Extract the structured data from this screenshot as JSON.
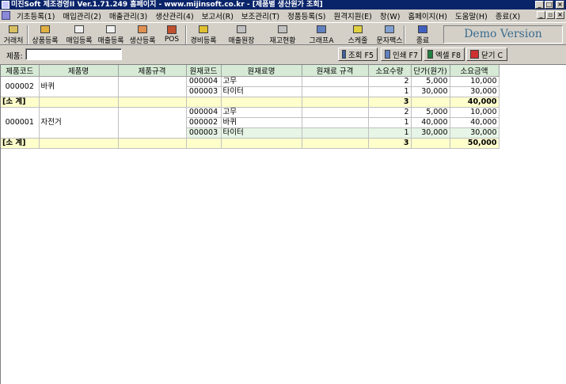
{
  "window": {
    "title": "미진Soft 제조경영II Ver.1.71.249        홈페이지 - www.mijinsoft.co.kr - [제품별 생산원가 조회]",
    "min": "_",
    "max": "□",
    "close": "×",
    "child_min": "_",
    "child_restore": "▫",
    "child_close": "×"
  },
  "menu": [
    "기초등록(1)",
    "매입관리(2)",
    "매출관리(3)",
    "생산관리(4)",
    "보고서(R)",
    "보조관리(T)",
    "정품등록(S)",
    "원격지원(E)",
    "창(W)",
    "홈페이지(H)",
    "도움말(H)",
    "종료(X)"
  ],
  "toolbar": [
    {
      "label": "거래처",
      "icon": "client-book-icon",
      "color": "#d8c060"
    },
    {
      "label": "상품등록",
      "icon": "product-box-icon",
      "color": "#e0b040"
    },
    {
      "label": "매입등록",
      "icon": "purchase-doc-icon",
      "color": "#f0f0f0"
    },
    {
      "label": "매출등록",
      "icon": "sales-doc-icon",
      "color": "#f0f0f0"
    },
    {
      "label": "생산등록",
      "icon": "production-icon",
      "color": "#e09050"
    },
    {
      "label": "POS",
      "icon": "pos-terminal-icon",
      "color": "#c05030"
    },
    {
      "label": "경비등록",
      "icon": "expense-coin-icon",
      "color": "#e0c030"
    },
    {
      "label": "매출원장",
      "icon": "sales-ledger-icon",
      "color": "#c0c0c0"
    },
    {
      "label": "재고현황",
      "icon": "inventory-icon",
      "color": "#c0c0c0"
    },
    {
      "label": "그래프A",
      "icon": "bar-chart-icon",
      "color": "#6080c0"
    },
    {
      "label": "스케줄",
      "icon": "schedule-clock-icon",
      "color": "#e0d040"
    },
    {
      "label": "문자팩스",
      "icon": "sms-fax-icon",
      "color": "#80a0d0"
    },
    {
      "label": "종료",
      "icon": "exit-icon",
      "color": "#4060c0"
    }
  ],
  "demo_label": "Demo Version",
  "filter": {
    "label": "제품:",
    "value": ""
  },
  "actions": [
    {
      "label": "조회 F5",
      "icon": "search-icon",
      "color": "#4060a0"
    },
    {
      "label": "인쇄 F7",
      "icon": "printer-icon",
      "color": "#6080c0"
    },
    {
      "label": "엑셀 F8",
      "icon": "excel-icon",
      "color": "#208040"
    },
    {
      "label": "닫기 C",
      "icon": "close-icon",
      "color": "#d03030"
    }
  ],
  "grid": {
    "columns": [
      "제품코드",
      "제품명",
      "제품규격",
      "원재코드",
      "원재료명",
      "원재료 규격",
      "소요수량",
      "단가(원가)",
      "소요금액"
    ],
    "groups": [
      {
        "code": "000002",
        "name": "바퀴",
        "spec": "",
        "rows": [
          {
            "mcode": "000004",
            "mname": "고무",
            "mspec": "",
            "qty": "2",
            "price": "5,000",
            "amount": "10,000"
          },
          {
            "mcode": "000003",
            "mname": "타이터",
            "mspec": "",
            "qty": "1",
            "price": "30,000",
            "amount": "30,000"
          }
        ],
        "subtotal_label": "[소 계]",
        "subtotal_qty": "3",
        "subtotal_amount": "40,000"
      },
      {
        "code": "000001",
        "name": "자전거",
        "spec": "",
        "rows": [
          {
            "mcode": "000004",
            "mname": "고무",
            "mspec": "",
            "qty": "2",
            "price": "5,000",
            "amount": "10,000"
          },
          {
            "mcode": "000002",
            "mname": "바퀴",
            "mspec": "",
            "qty": "1",
            "price": "40,000",
            "amount": "40,000"
          },
          {
            "mcode": "000003",
            "mname": "타이터",
            "mspec": "",
            "qty": "1",
            "price": "30,000",
            "amount": "30,000"
          }
        ],
        "subtotal_label": "[소 계]",
        "subtotal_qty": "3",
        "subtotal_amount": "50,000"
      }
    ]
  }
}
